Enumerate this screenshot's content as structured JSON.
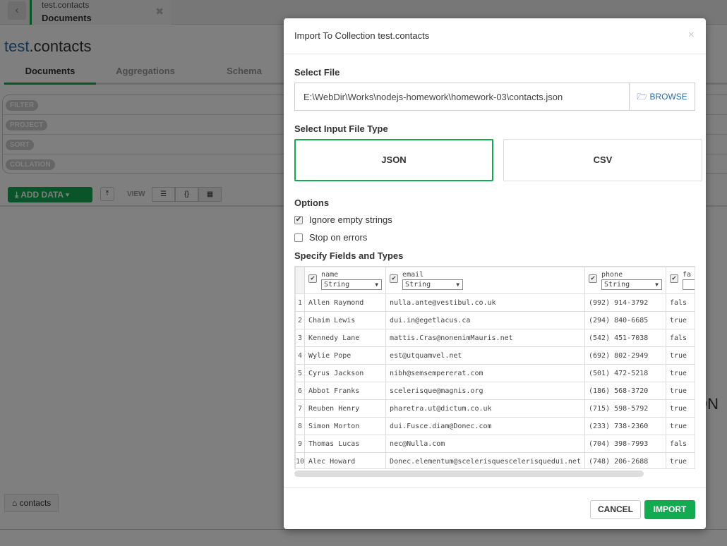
{
  "bg": {
    "tab_title": "test.contacts",
    "tab_sub": "Documents",
    "ns_db": "test",
    "ns_coll": ".contacts",
    "subtabs": [
      "Documents",
      "Aggregations",
      "Schema"
    ],
    "query": [
      "FILTER",
      "PROJECT",
      "SORT",
      "COLLATION"
    ],
    "add_data": "ADD DATA",
    "view": "VIEW",
    "collection_tab": "contacts",
    "peek1": ".",
    "peek2": "ON c"
  },
  "modal": {
    "title": "Import To Collection test.contacts",
    "select_file": "Select File",
    "file_path": "E:\\WebDir\\Works\\nodejs-homework\\homework-03\\contacts.json",
    "browse": "BROWSE",
    "select_type": "Select Input File Type",
    "types": [
      "JSON",
      "CSV"
    ],
    "selected_type": "JSON",
    "options_label": "Options",
    "options": [
      {
        "label": "Ignore empty strings",
        "checked": true
      },
      {
        "label": "Stop on errors",
        "checked": false
      }
    ],
    "fields_label": "Specify Fields and Types",
    "columns": [
      {
        "name": "name",
        "type": "String"
      },
      {
        "name": "email",
        "type": "String"
      },
      {
        "name": "phone",
        "type": "String"
      },
      {
        "name": "fa",
        "type": ""
      }
    ],
    "rows": [
      [
        "1",
        "Allen Raymond",
        "nulla.ante@vestibul.co.uk",
        "(992) 914-3792",
        "fals"
      ],
      [
        "2",
        "Chaim Lewis",
        "dui.in@egetlacus.ca",
        "(294) 840-6685",
        "true"
      ],
      [
        "3",
        "Kennedy Lane",
        "mattis.Cras@nonenimMauris.net",
        "(542) 451-7038",
        "fals"
      ],
      [
        "4",
        "Wylie Pope",
        "est@utquamvel.net",
        "(692) 802-2949",
        "true"
      ],
      [
        "5",
        "Cyrus Jackson",
        "nibh@semsempererat.com",
        "(501) 472-5218",
        "true"
      ],
      [
        "6",
        "Abbot Franks",
        "scelerisque@magnis.org",
        "(186) 568-3720",
        "true"
      ],
      [
        "7",
        "Reuben Henry",
        "pharetra.ut@dictum.co.uk",
        "(715) 598-5792",
        "true"
      ],
      [
        "8",
        "Simon Morton",
        "dui.Fusce.diam@Donec.com",
        "(233) 738-2360",
        "true"
      ],
      [
        "9",
        "Thomas Lucas",
        "nec@Nulla.com",
        "(704) 398-7993",
        "fals"
      ],
      [
        "10",
        "Alec Howard",
        "Donec.elementum@scelerisquescelerisquedui.net",
        "(748) 206-2688",
        "true"
      ]
    ],
    "cancel": "CANCEL",
    "import": "IMPORT"
  }
}
